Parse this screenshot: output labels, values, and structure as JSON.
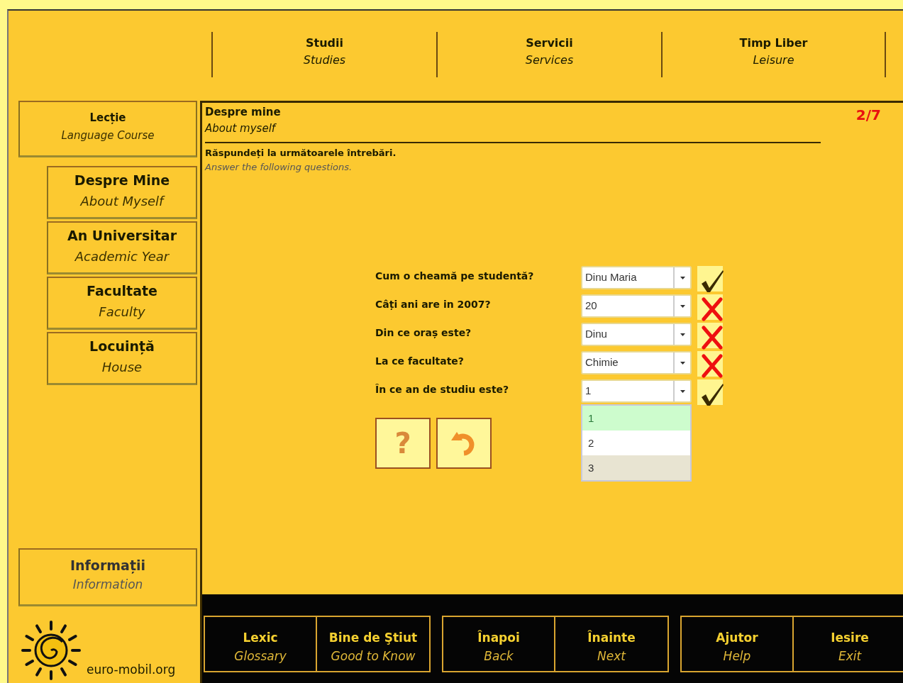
{
  "top_nav": [
    {
      "label": "Studii",
      "translation": "Studies"
    },
    {
      "label": "Servicii",
      "translation": "Services"
    },
    {
      "label": "Timp Liber",
      "translation": "Leisure"
    }
  ],
  "sidebar": {
    "heading": {
      "label": "Lecție",
      "translation": "Language Course"
    },
    "items": [
      {
        "label": "Despre Mine",
        "translation": "About Myself"
      },
      {
        "label": "An Universitar",
        "translation": "Academic Year"
      },
      {
        "label": "Facultate",
        "translation": "Faculty"
      },
      {
        "label": "Locuință",
        "translation": "House"
      }
    ],
    "info": {
      "label": "Informații",
      "translation": "Information"
    },
    "logo_text": "euro-mobil.org"
  },
  "content": {
    "title": "Despre mine",
    "title_translation": "About myself",
    "counter": "2/7",
    "instruction": "Răspundeți la următoarele întrebări.",
    "instruction_translation": "Answer the following questions.",
    "questions": [
      {
        "question": "Cum o cheamă pe studentă?",
        "answer": "Dinu Maria",
        "correct": true
      },
      {
        "question": "Câți ani are in 2007?",
        "answer": "20",
        "correct": false
      },
      {
        "question": "Din ce oraș este?",
        "answer": "Dinu",
        "correct": false
      },
      {
        "question": "La ce facultate?",
        "answer": "Chimie",
        "correct": false
      },
      {
        "question": "În ce an de studiu este?",
        "answer": "1",
        "correct": true,
        "options": [
          {
            "label": "1",
            "selected": true,
            "highlighted": false
          },
          {
            "label": "2",
            "selected": false,
            "highlighted": false
          },
          {
            "label": "3",
            "selected": false,
            "highlighted": true
          }
        ]
      }
    ],
    "actions": [
      {
        "kind": "hint",
        "label": "?"
      },
      {
        "kind": "reset"
      }
    ]
  },
  "footer": {
    "groups": [
      [
        {
          "label": "Lexic",
          "translation": "Glossary"
        },
        {
          "label": "Bine de Ştiut",
          "translation": "Good to Know"
        }
      ],
      [
        {
          "label": "Înapoi",
          "translation": "Back"
        },
        {
          "label": "Înainte",
          "translation": "Next"
        }
      ],
      [
        {
          "label": "Ajutor",
          "translation": "Help"
        },
        {
          "label": "Iesire",
          "translation": "Exit"
        }
      ]
    ]
  }
}
